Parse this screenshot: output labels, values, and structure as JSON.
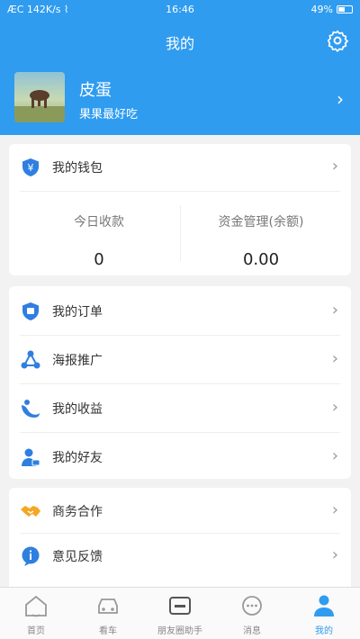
{
  "status_bar": {
    "left": "ÆC 142K/s ⌇",
    "time": "16:46",
    "battery_percent": "49%",
    "battery_level": 0.49
  },
  "header": {
    "title": "我的"
  },
  "profile": {
    "name": "皮蛋",
    "motto": "果果最好吃"
  },
  "wallet": {
    "label": "我的钱包",
    "stats": [
      {
        "label": "今日收款",
        "value": "0"
      },
      {
        "label": "资金管理(余额)",
        "value": "0.00"
      }
    ]
  },
  "menu_main": [
    {
      "label": "我的订单",
      "icon": "shield-order-icon"
    },
    {
      "label": "海报推广",
      "icon": "share-icon"
    },
    {
      "label": "我的收益",
      "icon": "earnings-icon"
    },
    {
      "label": "我的好友",
      "icon": "friends-icon"
    }
  ],
  "menu_more": [
    {
      "label": "商务合作",
      "icon": "handshake-icon"
    },
    {
      "label": "意见反馈",
      "icon": "feedback-icon"
    }
  ],
  "bottom_nav": [
    {
      "label": "首页",
      "icon": "home-icon"
    },
    {
      "label": "看车",
      "icon": "car-icon"
    },
    {
      "label": "朋友圈助手",
      "icon": "assistant-icon"
    },
    {
      "label": "消息",
      "icon": "message-icon"
    },
    {
      "label": "我的",
      "icon": "profile-icon",
      "active": true
    }
  ],
  "colors": {
    "accent": "#2f9cf0",
    "background": "#f2f2f2",
    "card": "#ffffff"
  }
}
